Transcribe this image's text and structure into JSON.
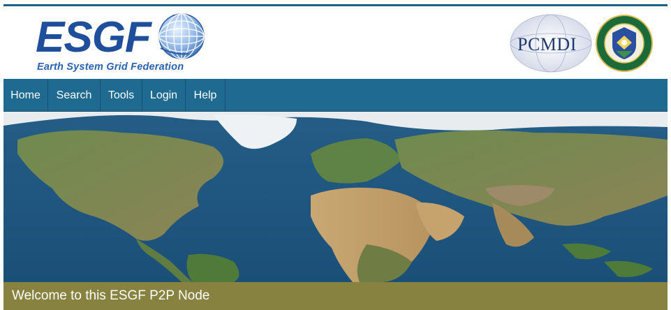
{
  "brand": {
    "name": "ESGF",
    "subtitle": "Earth System Grid Federation",
    "primary_color": "#1f4e9a",
    "globe_icon": "globe-grid-icon"
  },
  "partners": {
    "pcmdi_label": "PCMDI",
    "doe_seal_icon": "doe-seal-icon"
  },
  "nav": {
    "bar_color": "#1f6a91",
    "items": [
      {
        "label": "Home"
      },
      {
        "label": "Search"
      },
      {
        "label": "Tools"
      },
      {
        "label": "Login"
      },
      {
        "label": "Help"
      }
    ]
  },
  "banner": {
    "image": "world-map-satellite"
  },
  "welcome": {
    "text": "Welcome to this ESGF P2P Node",
    "bar_color": "#87823f"
  }
}
